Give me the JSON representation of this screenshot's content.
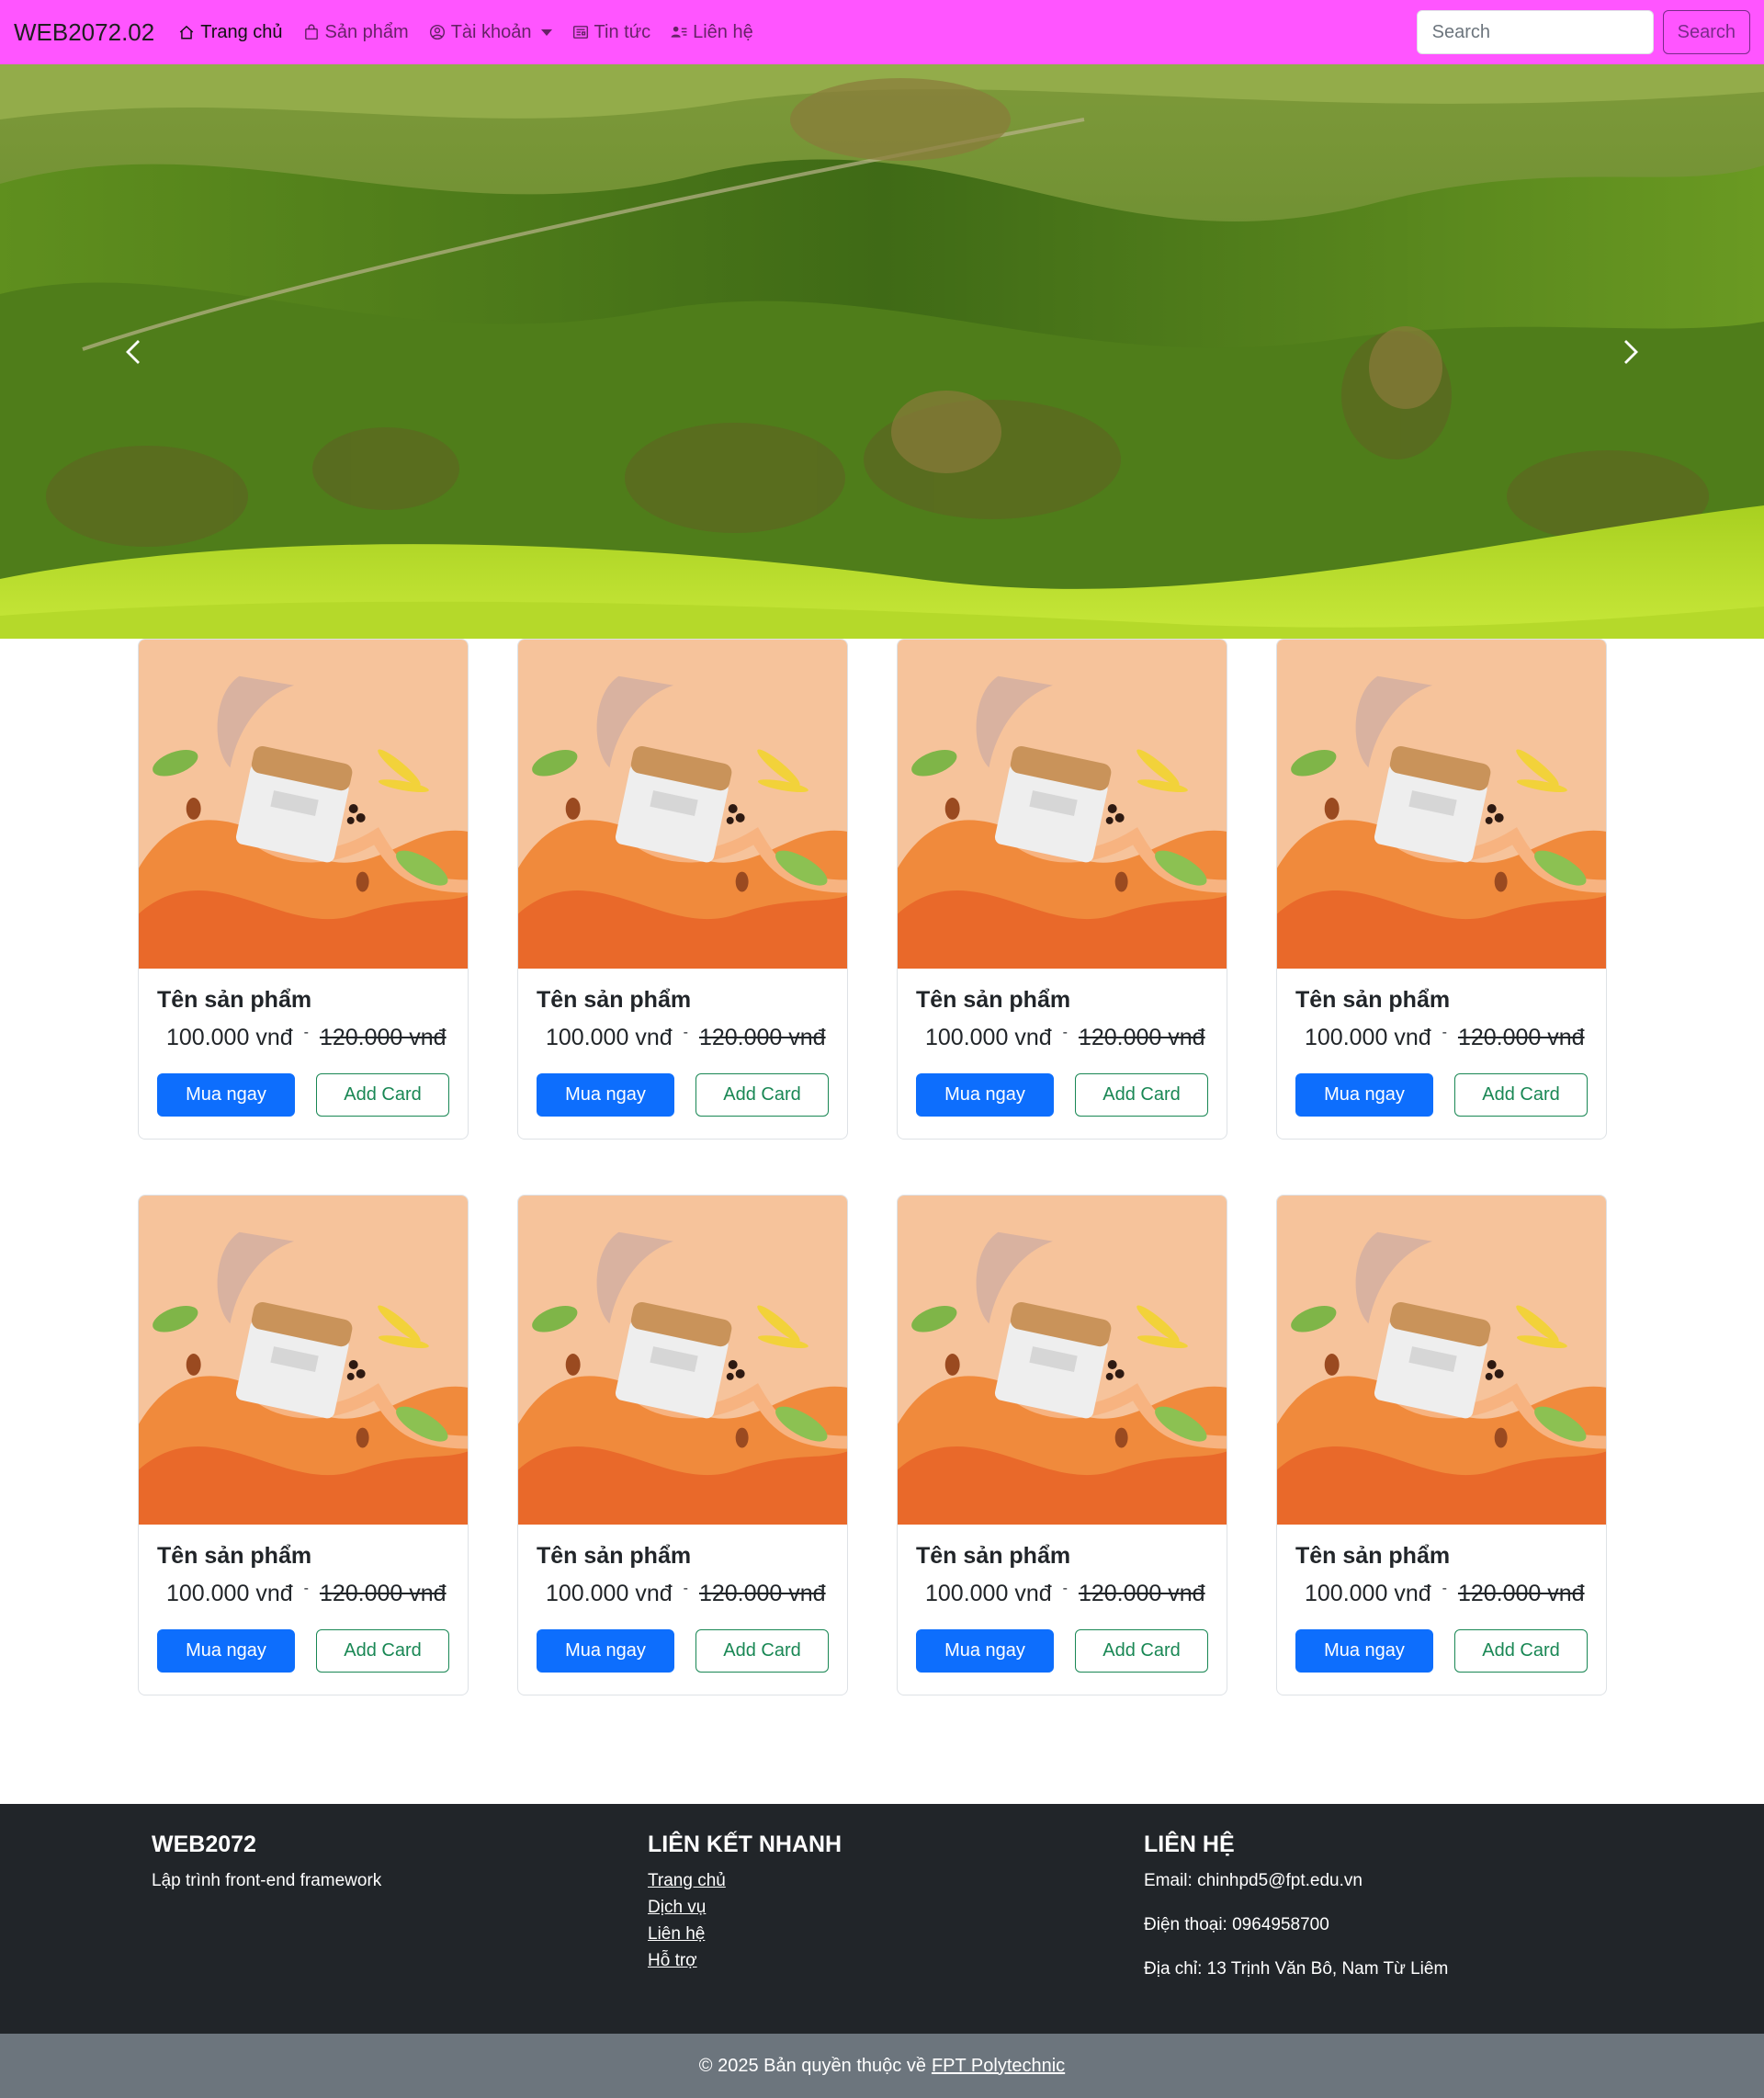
{
  "navbar": {
    "brand": "WEB2072.02",
    "items": [
      {
        "label": "Trang chủ",
        "icon": "house-icon",
        "active": true
      },
      {
        "label": "Sản phẩm",
        "icon": "bag-icon"
      },
      {
        "label": "Tài khoản",
        "icon": "person-circle-icon",
        "dropdown": true
      },
      {
        "label": "Tin tức",
        "icon": "newspaper-icon"
      },
      {
        "label": "Liên hệ",
        "icon": "person-lines-icon"
      }
    ],
    "search_placeholder": "Search",
    "search_button": "Search",
    "accent_color": "#ff55ff"
  },
  "carousel": {
    "prev_icon": "chevron-left-icon",
    "next_icon": "chevron-right-icon"
  },
  "products": [
    {
      "name": "Tên sản phẩm",
      "price": "100.000 vnđ",
      "separator": "-",
      "old_price": "120.000 vnđ",
      "buy_label": "Mua ngay",
      "add_label": "Add Card"
    },
    {
      "name": "Tên sản phẩm",
      "price": "100.000 vnđ",
      "separator": "-",
      "old_price": "120.000 vnđ",
      "buy_label": "Mua ngay",
      "add_label": "Add Card"
    },
    {
      "name": "Tên sản phẩm",
      "price": "100.000 vnđ",
      "separator": "-",
      "old_price": "120.000 vnđ",
      "buy_label": "Mua ngay",
      "add_label": "Add Card"
    },
    {
      "name": "Tên sản phẩm",
      "price": "100.000 vnđ",
      "separator": "-",
      "old_price": "120.000 vnđ",
      "buy_label": "Mua ngay",
      "add_label": "Add Card"
    },
    {
      "name": "Tên sản phẩm",
      "price": "100.000 vnđ",
      "separator": "-",
      "old_price": "120.000 vnđ",
      "buy_label": "Mua ngay",
      "add_label": "Add Card"
    },
    {
      "name": "Tên sản phẩm",
      "price": "100.000 vnđ",
      "separator": "-",
      "old_price": "120.000 vnđ",
      "buy_label": "Mua ngay",
      "add_label": "Add Card"
    },
    {
      "name": "Tên sản phẩm",
      "price": "100.000 vnđ",
      "separator": "-",
      "old_price": "120.000 vnđ",
      "buy_label": "Mua ngay",
      "add_label": "Add Card"
    },
    {
      "name": "Tên sản phẩm",
      "price": "100.000 vnđ",
      "separator": "-",
      "old_price": "120.000 vnđ",
      "buy_label": "Mua ngay",
      "add_label": "Add Card"
    }
  ],
  "footer": {
    "about": {
      "title": "WEB2072",
      "text": "Lập trình front-end framework"
    },
    "links": {
      "title": "LIÊN KẾT NHANH",
      "items": [
        "Trang chủ",
        "Dịch vụ",
        "Liên hệ",
        "Hỗ trợ"
      ]
    },
    "contact": {
      "title": "LIÊN HỆ",
      "email": "Email: chinhpd5@fpt.edu.vn",
      "phone": "Điện thoại: 0964958700",
      "address": "Địa chỉ: 13 Trịnh Văn Bô, Nam Từ Liêm"
    },
    "copyright_prefix": "© 2025 Bản quyền thuộc về",
    "copyright_link": "FPT Polytechnic"
  }
}
